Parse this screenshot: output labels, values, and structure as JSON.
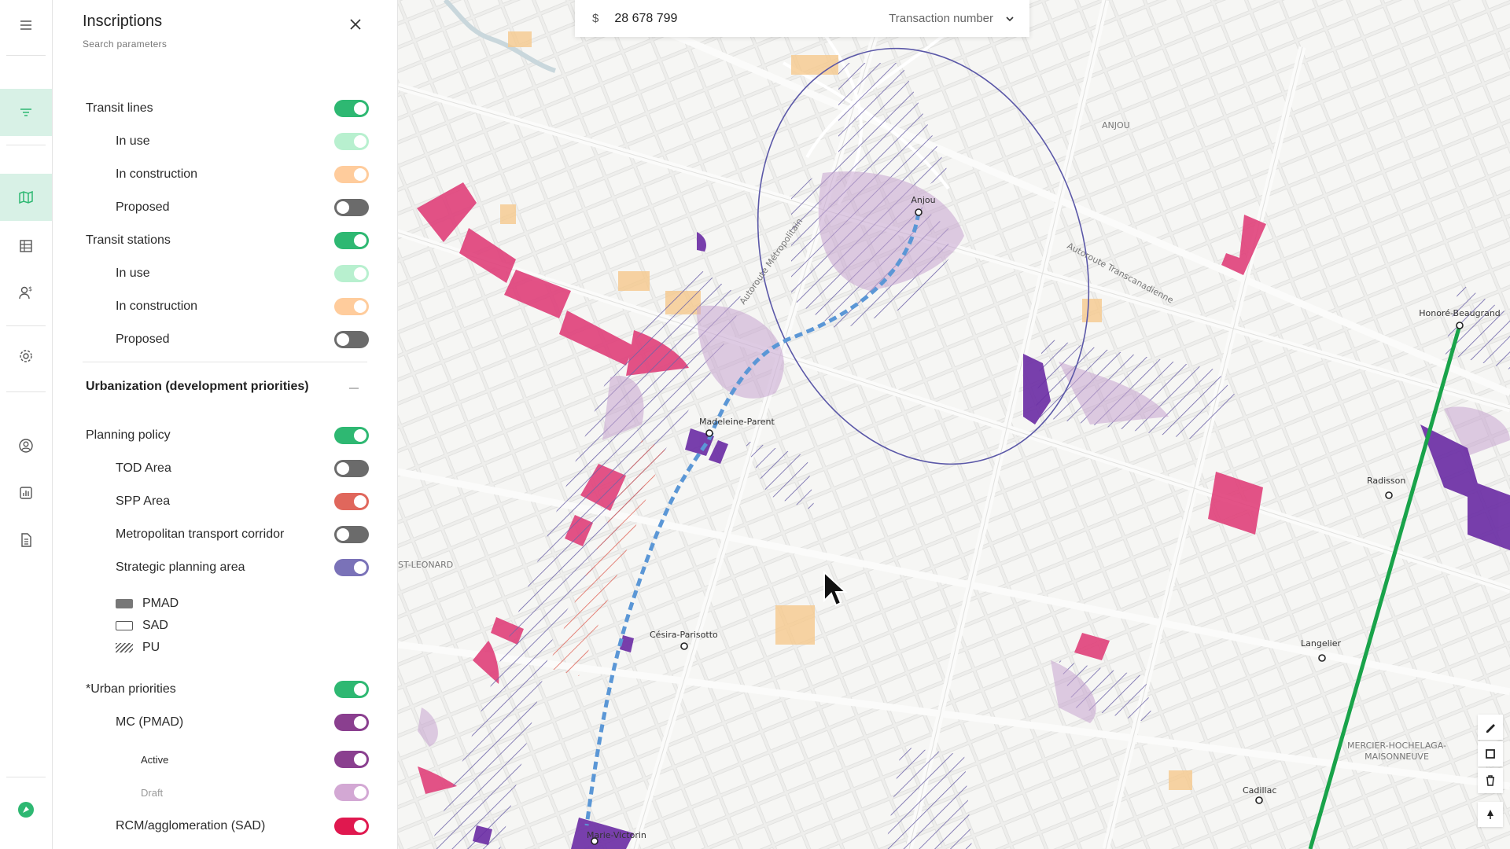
{
  "rail": {
    "menu_icon": "hamburger-icon",
    "items": [
      {
        "icon": "filter-icon",
        "active": true
      },
      {
        "icon": "map-icon",
        "active": true
      },
      {
        "icon": "table-icon"
      },
      {
        "icon": "users-dollar-icon"
      },
      {
        "icon": "gear-icon"
      },
      {
        "icon": "user-circle-icon"
      },
      {
        "icon": "bar-chart-icon"
      },
      {
        "icon": "document-icon"
      },
      {
        "icon": "app-logo-icon"
      }
    ]
  },
  "panel": {
    "title": "Inscriptions",
    "subtitle": "Search parameters",
    "rows": [
      {
        "label": "Transit lines",
        "level": 0,
        "on": true,
        "color": "#2eb872"
      },
      {
        "label": "In use",
        "level": 1,
        "on": true,
        "color": "#b8f0cf"
      },
      {
        "label": "In construction",
        "level": 1,
        "on": true,
        "color": "#ffcc9c"
      },
      {
        "label": "Proposed",
        "level": 1,
        "on": false,
        "color": "#6b6b6b"
      },
      {
        "label": "Transit stations",
        "level": 0,
        "on": true,
        "color": "#2eb872"
      },
      {
        "label": "In use",
        "level": 1,
        "on": true,
        "color": "#b8f0cf"
      },
      {
        "label": "In construction",
        "level": 1,
        "on": true,
        "color": "#ffcc9c"
      },
      {
        "label": "Proposed",
        "level": 1,
        "on": false,
        "color": "#6b6b6b"
      }
    ],
    "section_title": "Urbanization (development priorities)",
    "rows2": [
      {
        "label": "Planning policy",
        "level": 0,
        "on": true,
        "color": "#2eb872"
      },
      {
        "label": "TOD Area",
        "level": 1,
        "on": false,
        "color": "#6b6b6b"
      },
      {
        "label": "SPP Area",
        "level": 1,
        "on": true,
        "color": "#e0675c"
      },
      {
        "label": "Metropolitan transport corridor",
        "level": 1,
        "on": false,
        "color": "#6b6b6b"
      },
      {
        "label": "Strategic planning area",
        "level": 1,
        "on": true,
        "color": "#7a72b8"
      }
    ],
    "legend": [
      {
        "label": "PMAD",
        "style": "filled",
        "color": "#777777"
      },
      {
        "label": "SAD",
        "style": "outline",
        "color": "#555555"
      },
      {
        "label": "PU",
        "style": "hatched",
        "color": "#555555"
      }
    ],
    "rows3": [
      {
        "label": "*Urban priorities",
        "level": 0,
        "on": true,
        "color": "#2eb872"
      },
      {
        "label": "MC (PMAD)",
        "level": 1,
        "on": true,
        "color": "#8a3f8f"
      },
      {
        "label": "Active",
        "level": 2,
        "on": true,
        "color": "#8a3f8f"
      },
      {
        "label": "Draft",
        "level": 2,
        "on": true,
        "color": "#d3a8d4",
        "dim": true
      },
      {
        "label": "RCM/agglomeration (SAD)",
        "level": 1,
        "on": true,
        "color": "#e0184f"
      }
    ]
  },
  "search": {
    "currency": "$",
    "value": "28 678 799",
    "type": "Transaction number"
  },
  "map_labels": {
    "anjou_area": "ANJOU",
    "anjou": "Anjou",
    "autoroute_trans": "Autoroute Transcanadienne",
    "autoroute_metro": "Autoroute Métropolitain",
    "madeleine": "Madeleine-Parent",
    "honore": "Honoré-Beaugrand",
    "radisson": "Radisson",
    "leonard": "ST-LEONARD",
    "cesira": "Césira-Parisotto",
    "langelier": "Langelier",
    "cadillac": "Cadillac",
    "mercier": "MERCIER-HOCHELAGA-",
    "maisonneuve": "MAISONNEUVE",
    "marie": "Marie-Victorin"
  }
}
